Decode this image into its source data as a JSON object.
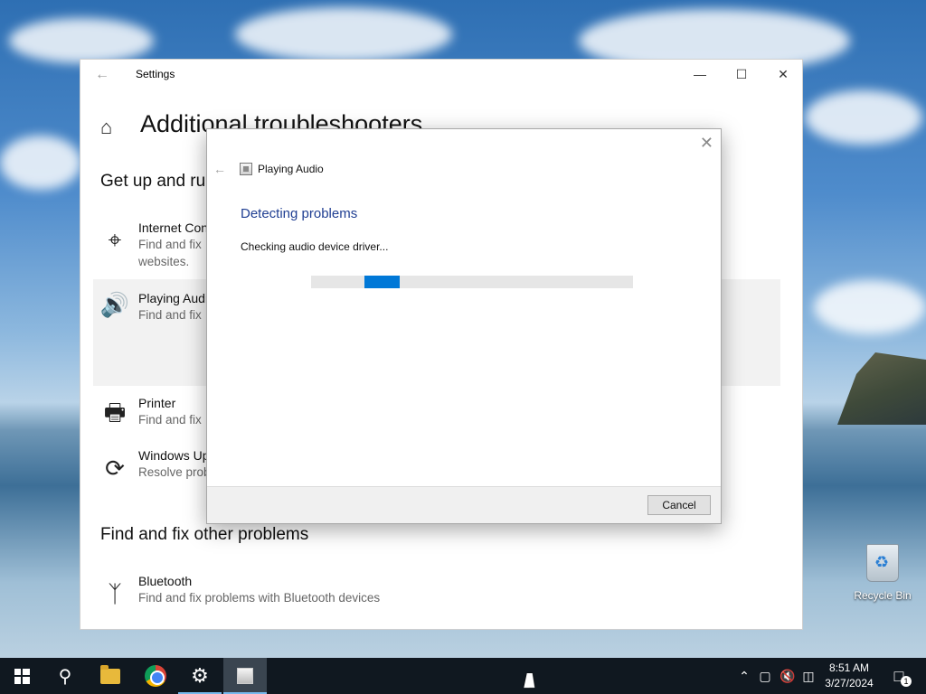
{
  "settings": {
    "title": "Settings",
    "page_title": "Additional troubleshooters",
    "section_1": "Get up and ru",
    "items": [
      {
        "title": "Internet Con",
        "desc": "Find and fix",
        "desc2": "websites."
      },
      {
        "title": "Playing Audi",
        "desc": "Find and fix"
      },
      {
        "title": "Printer",
        "desc": "Find and fix"
      },
      {
        "title": "Windows Up",
        "desc": "Resolve prob"
      }
    ],
    "section_2": "Find and fix other problems",
    "bluetooth": {
      "title": "Bluetooth",
      "desc": "Find and fix problems with Bluetooth devices"
    }
  },
  "dialog": {
    "title": "Playing Audio",
    "heading": "Detecting problems",
    "status": "Checking audio device driver...",
    "progress_fraction": 0.11,
    "cancel_label": "Cancel"
  },
  "desktop": {
    "recycle_bin_label": "Recycle Bin"
  },
  "taskbar": {
    "time": "8:51 AM",
    "date": "3/27/2024",
    "notification_count": "1",
    "accent_color": "#76b9ed"
  },
  "icons": {
    "start": "windows-logo-icon",
    "search": "search-icon",
    "explorer": "folder-icon",
    "chrome": "chrome-icon",
    "settings": "gear-icon",
    "troubleshooter": "troubleshooter-icon"
  }
}
